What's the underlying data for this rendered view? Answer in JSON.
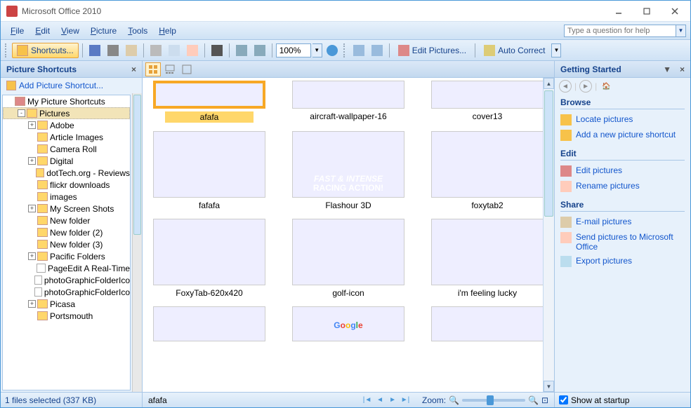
{
  "title": "Microsoft Office 2010",
  "menus": [
    "File",
    "Edit",
    "View",
    "Picture",
    "Tools",
    "Help"
  ],
  "help_placeholder": "Type a question for help",
  "toolbar": {
    "shortcuts": "Shortcuts...",
    "zoom": "100%",
    "edit_pictures": "Edit Pictures...",
    "auto_correct": "Auto Correct"
  },
  "left": {
    "header": "Picture Shortcuts",
    "add": "Add Picture Shortcut...",
    "root": "My Picture Shortcuts",
    "tree": [
      {
        "exp": "-",
        "label": "Pictures",
        "selected": true,
        "depth": 1
      },
      {
        "exp": "+",
        "label": "Adobe",
        "depth": 2
      },
      {
        "exp": "",
        "label": "Article Images",
        "depth": 2
      },
      {
        "exp": "",
        "label": "Camera Roll",
        "depth": 2
      },
      {
        "exp": "+",
        "label": "Digital",
        "depth": 2
      },
      {
        "exp": "",
        "label": "dotTech.org - Reviews",
        "depth": 2
      },
      {
        "exp": "",
        "label": "flickr downloads",
        "depth": 2
      },
      {
        "exp": "",
        "label": "images",
        "depth": 2
      },
      {
        "exp": "+",
        "label": "My Screen Shots",
        "depth": 2
      },
      {
        "exp": "",
        "label": "New folder",
        "depth": 2
      },
      {
        "exp": "",
        "label": "New folder (2)",
        "depth": 2
      },
      {
        "exp": "",
        "label": "New folder (3)",
        "depth": 2
      },
      {
        "exp": "+",
        "label": "Pacific Folders",
        "depth": 2
      },
      {
        "exp": "",
        "label": "PageEdit  A Real-Time",
        "depth": 2,
        "file": true
      },
      {
        "exp": "",
        "label": "photoGraphicFolderIco",
        "depth": 2,
        "file": true
      },
      {
        "exp": "",
        "label": "photoGraphicFolderIco",
        "depth": 2,
        "file": true
      },
      {
        "exp": "+",
        "label": "Picasa",
        "depth": 2
      },
      {
        "exp": "",
        "label": "Portsmouth",
        "depth": 2
      }
    ]
  },
  "gallery": [
    {
      "name": "afafa",
      "ph": "ph1",
      "selected": true,
      "first": true
    },
    {
      "name": "aircraft-wallpaper-16",
      "ph": "ph1",
      "first": true
    },
    {
      "name": "cover13",
      "ph": "ph1",
      "first": true
    },
    {
      "name": "fafafa",
      "ph": "ph3"
    },
    {
      "name": "Flashour 3D",
      "ph": "ph2"
    },
    {
      "name": "foxytab2",
      "ph": "ph3"
    },
    {
      "name": "FoxyTab-620x420",
      "ph": "ph3"
    },
    {
      "name": "golf-icon",
      "ph": "ph-golf"
    },
    {
      "name": "i'm feeling lucky",
      "ph": "ph3"
    },
    {
      "name": "",
      "ph": "ph3",
      "partial": true
    },
    {
      "name": "",
      "ph": "ph-google",
      "partial": true,
      "google": true
    },
    {
      "name": "",
      "ph": "ph-light",
      "partial": true
    }
  ],
  "google_text": "Google",
  "right": {
    "header": "Getting Started",
    "sections": [
      {
        "head": "Browse",
        "links": [
          {
            "icon": "li-locate",
            "text": "Locate pictures"
          },
          {
            "icon": "li-add",
            "text": "Add a new picture shortcut"
          }
        ]
      },
      {
        "head": "Edit",
        "links": [
          {
            "icon": "li-edit",
            "text": "Edit pictures"
          },
          {
            "icon": "li-rename",
            "text": "Rename pictures"
          }
        ]
      },
      {
        "head": "Share",
        "links": [
          {
            "icon": "li-email",
            "text": "E-mail pictures"
          },
          {
            "icon": "li-send",
            "text": "Send pictures to Microsoft Office"
          },
          {
            "icon": "li-export",
            "text": "Export pictures"
          }
        ]
      }
    ]
  },
  "status": {
    "files": "1 files selected (337 KB)",
    "current": "afafa",
    "zoom_label": "Zoom:",
    "show_startup": "Show at startup"
  }
}
